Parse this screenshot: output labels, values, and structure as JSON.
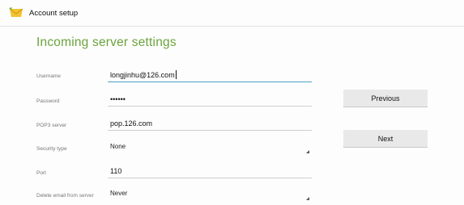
{
  "appbar": {
    "title": "Account setup",
    "icon": "mail-account-icon"
  },
  "heading": "Incoming server settings",
  "form": {
    "username": {
      "label": "Username",
      "value": "longjinhu@126.com"
    },
    "password": {
      "label": "Password",
      "value": "••••••"
    },
    "server": {
      "label": "POP3 server",
      "value": "pop.126.com"
    },
    "security": {
      "label": "Security type",
      "value": "None"
    },
    "port": {
      "label": "Port",
      "value": "110"
    },
    "delete": {
      "label": "Delete email from server",
      "value": "Never"
    }
  },
  "buttons": {
    "previous": "Previous",
    "next": "Next"
  },
  "colors": {
    "accent": "#6aa43c",
    "focus": "#4aa2c8"
  }
}
